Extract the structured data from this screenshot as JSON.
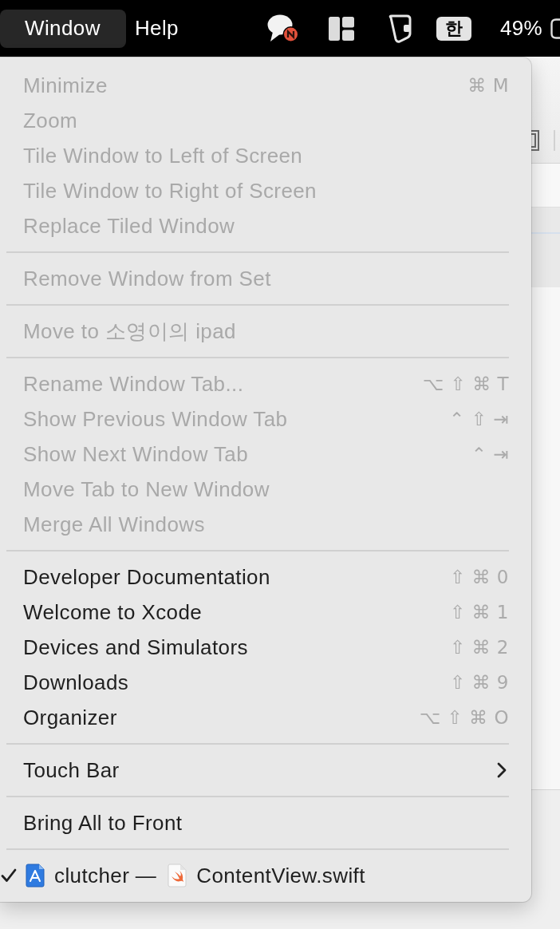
{
  "menu_bar": {
    "menus": [
      {
        "label": "Window",
        "selected": true
      },
      {
        "label": "Help",
        "selected": false
      }
    ],
    "input_source": "한",
    "battery": "49%"
  },
  "menu": {
    "sections": [
      {
        "items": [
          {
            "kind": "command",
            "label": "Minimize",
            "shortcut": "⌘ M",
            "disabled": true,
            "checked": false
          },
          {
            "kind": "command",
            "label": "Zoom",
            "disabled": true,
            "checked": false
          },
          {
            "kind": "command",
            "label": "Tile Window to Left of Screen",
            "disabled": true,
            "checked": false
          },
          {
            "kind": "command",
            "label": "Tile Window to Right of Screen",
            "disabled": true,
            "checked": false
          },
          {
            "kind": "command",
            "label": "Replace Tiled Window",
            "disabled": true,
            "checked": false
          }
        ]
      },
      {
        "items": [
          {
            "kind": "command",
            "label": "Remove Window from Set",
            "disabled": true,
            "checked": false
          }
        ]
      },
      {
        "items": [
          {
            "kind": "command",
            "label": "Move to 소영이의 ipad",
            "disabled": true,
            "checked": false
          }
        ]
      },
      {
        "items": [
          {
            "kind": "command",
            "label": "Rename Window Tab...",
            "shortcut": "⌥ ⇧ ⌘ T",
            "disabled": true,
            "checked": false
          },
          {
            "kind": "command",
            "label": "Show Previous Window Tab",
            "shortcut": "⌃ ⇧ ⇥",
            "disabled": true,
            "checked": false
          },
          {
            "kind": "command",
            "label": "Show Next Window Tab",
            "shortcut": "⌃ ⇥",
            "disabled": true,
            "checked": false
          },
          {
            "kind": "command",
            "label": "Move Tab to New Window",
            "disabled": true,
            "checked": false
          },
          {
            "kind": "command",
            "label": "Merge All Windows",
            "disabled": true,
            "checked": false
          }
        ]
      },
      {
        "items": [
          {
            "kind": "command",
            "label": "Developer Documentation",
            "shortcut": "⇧ ⌘ 0",
            "disabled": false,
            "checked": false
          },
          {
            "kind": "command",
            "label": "Welcome to Xcode",
            "shortcut": "⇧ ⌘ 1",
            "disabled": false,
            "checked": false
          },
          {
            "kind": "command",
            "label": "Devices and Simulators",
            "shortcut": "⇧ ⌘ 2",
            "disabled": false,
            "checked": false
          },
          {
            "kind": "command",
            "label": "Downloads",
            "shortcut": "⇧ ⌘ 9",
            "disabled": false,
            "checked": false
          },
          {
            "kind": "command",
            "label": "Organizer",
            "shortcut": "⌥ ⇧ ⌘ O",
            "disabled": false,
            "checked": false
          }
        ]
      },
      {
        "items": [
          {
            "kind": "submenu",
            "label": "Touch Bar",
            "disabled": false,
            "checked": false
          }
        ]
      },
      {
        "items": [
          {
            "kind": "command",
            "label": "Bring All to Front",
            "disabled": false,
            "checked": false
          }
        ]
      },
      {
        "items": [
          {
            "kind": "window",
            "project": "clutcher —",
            "file": "ContentView.swift",
            "disabled": false,
            "checked": true
          }
        ]
      }
    ]
  }
}
